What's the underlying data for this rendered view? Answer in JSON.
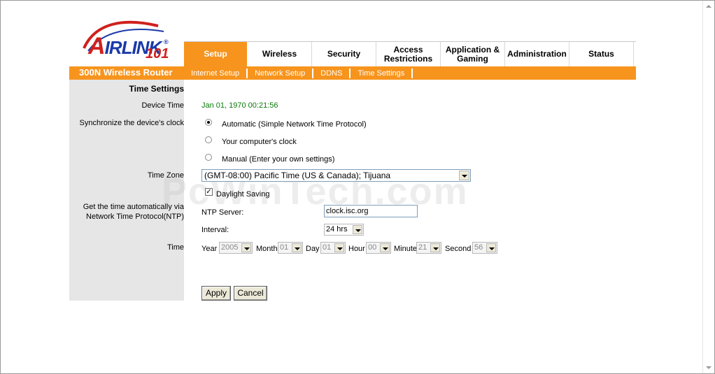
{
  "logo": {
    "text": "AIRLINK",
    "first_letter": "A",
    "rest": "IRLINK",
    "reg": "®",
    "number": "101"
  },
  "nav": {
    "tabs": [
      {
        "label": "Setup",
        "active": true
      },
      {
        "label": "Wireless"
      },
      {
        "label": "Security"
      },
      {
        "label": "Access Restrictions"
      },
      {
        "label": "Application & Gaming"
      },
      {
        "label": "Administration"
      },
      {
        "label": "Status"
      }
    ]
  },
  "header": {
    "model": "300N Wireless Router"
  },
  "subnav": {
    "items": [
      "Internet Setup",
      "Network Setup",
      "DDNS",
      "Time Settings"
    ]
  },
  "section": {
    "title": "Time Settings"
  },
  "labels": {
    "device_time": "Device Time",
    "sync_clock": "Synchronize the device's clock",
    "time_zone": "Time Zone",
    "ntp_line1": "Get the time automatically via",
    "ntp_line2": "Network Time Protocol(NTP)",
    "time": "Time"
  },
  "device_time": "Jan 01, 1970 00:21:56",
  "sync_options": [
    {
      "label": "Automatic (Simple Network Time Protocol)",
      "selected": true
    },
    {
      "label": "Your computer's clock",
      "selected": false
    },
    {
      "label": "Manual (Enter your own settings)",
      "selected": false
    }
  ],
  "time_zone": {
    "value": "(GMT-08:00) Pacific Time (US & Canada); Tijuana"
  },
  "daylight_saving": {
    "label": "Daylight Saving",
    "checked": true
  },
  "ntp": {
    "server_label": "NTP Server:",
    "server_value": "clock.isc.org",
    "interval_label": "Interval:",
    "interval_value": "24 hrs"
  },
  "manual_time": {
    "year_label": "Year",
    "year": "2005",
    "month_label": "Month",
    "month": "01",
    "day_label": "Day",
    "day": "01",
    "hour_label": "Hour",
    "hour": "00",
    "minute_label": "Minute",
    "minute": "21",
    "second_label": "Second",
    "second": "56"
  },
  "buttons": {
    "apply": "Apply",
    "cancel": "Cancel"
  },
  "watermark": "PcWinTech.com",
  "colors": {
    "accent": "#f7941d",
    "left_panel": "#e6e6e6",
    "device_time": "#0a7a0a"
  }
}
